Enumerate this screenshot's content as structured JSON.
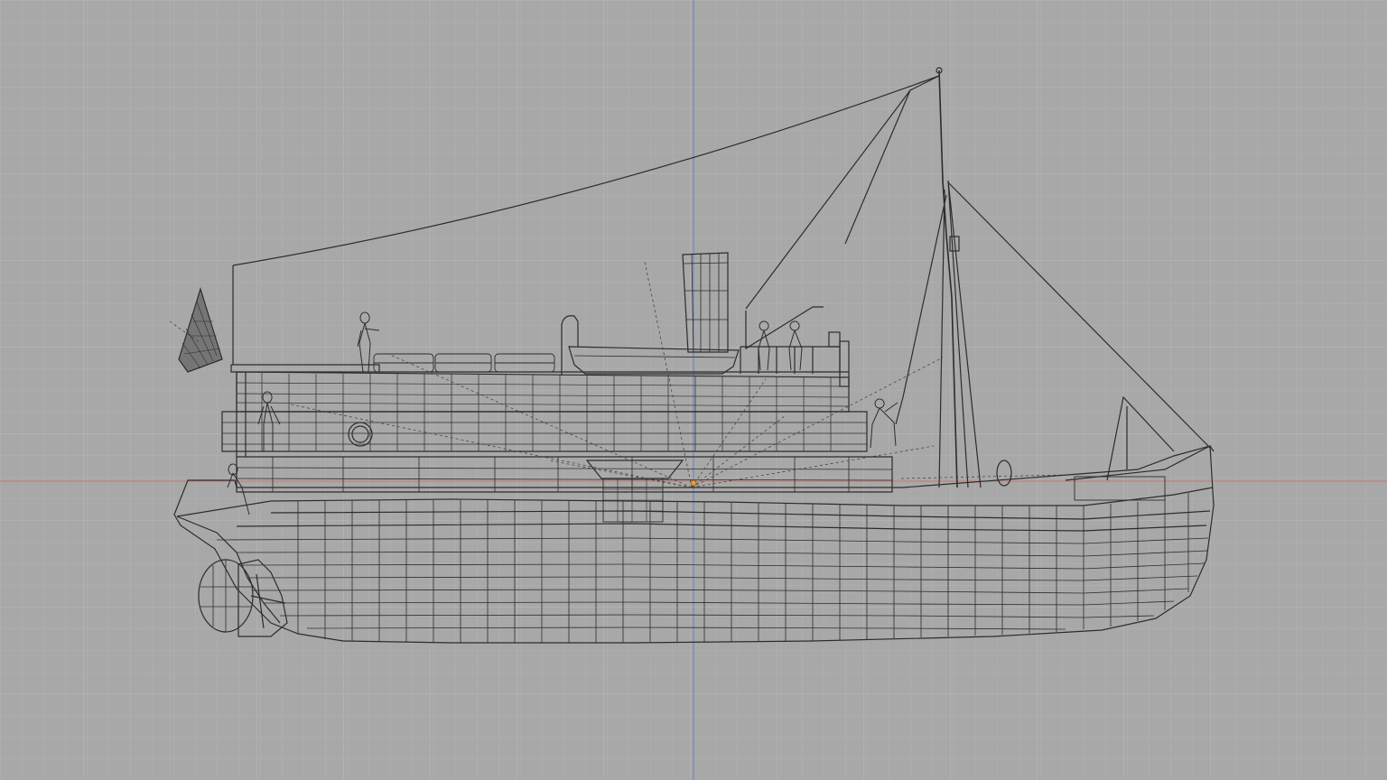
{
  "viewport": {
    "view": "orthographic-side",
    "mode": "wireframe",
    "grid": true,
    "background_color": "#a9a9a9",
    "grid_minor_color": "#b4b4b4",
    "grid_major_color": "#bebebe",
    "wire_color": "#2f2f2f",
    "x_axis_color": "#d87a7a",
    "y_axis_color": "#6f8fc8",
    "pivot_color": "#e89a2a"
  },
  "model": {
    "subject": "steam-tug-boat",
    "parts": [
      "hull",
      "bow",
      "rudder",
      "propeller",
      "deckhouse",
      "funnel",
      "lifeboat",
      "mast",
      "flag",
      "crew-figures",
      "rigging",
      "porthole",
      "life-rafts",
      "cargo-hatch"
    ]
  }
}
